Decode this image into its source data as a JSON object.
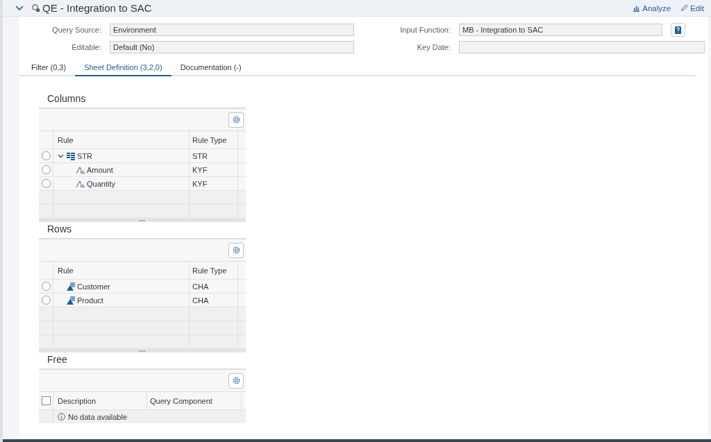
{
  "header": {
    "title": "QE - Integration to SAC",
    "expanded": true,
    "actions": [
      {
        "label": "Analyze",
        "kind": "chart"
      },
      {
        "label": "Edit",
        "kind": "pencil"
      }
    ]
  },
  "form": {
    "left": [
      {
        "label": "Query Source:",
        "value": "Environment"
      },
      {
        "label": "Editable:",
        "value": "Default (No)"
      }
    ],
    "right": [
      {
        "label": "Input Function:",
        "value": "MB - Integration to SAC",
        "help": true
      },
      {
        "label": "Key Date:"
      }
    ]
  },
  "tabs": [
    {
      "label": "Filter (0,3)",
      "selected": false
    },
    {
      "label": "Sheet Definition (3,2,0)",
      "selected": true
    },
    {
      "label": "Documentation (-)",
      "selected": false
    }
  ],
  "sections": [
    {
      "title": "Columns",
      "columns": [
        "Rule",
        "Rule Type"
      ],
      "rows": [
        {
          "rule": "STR",
          "type": "STR",
          "kind": "structure",
          "selected": false,
          "expanded": true,
          "children": [
            {
              "rule": "Amount",
              "type": "KYF",
              "kind": "keyfigure",
              "selected": false
            },
            {
              "rule": "Quantity",
              "type": "KYF",
              "kind": "keyfigure",
              "selected": false
            }
          ]
        }
      ]
    },
    {
      "title": "Rows",
      "columns": [
        "Rule",
        "Rule Type"
      ],
      "rows": [
        {
          "rule": "Customer",
          "type": "CHA",
          "kind": "characteristic",
          "selected": false
        },
        {
          "rule": "Product",
          "type": "CHA",
          "kind": "characteristic",
          "selected": false
        }
      ]
    },
    {
      "title": "Free",
      "columns": [
        "Description",
        "Query Component"
      ],
      "all_checked": false,
      "no_data": "No data available"
    }
  ]
}
